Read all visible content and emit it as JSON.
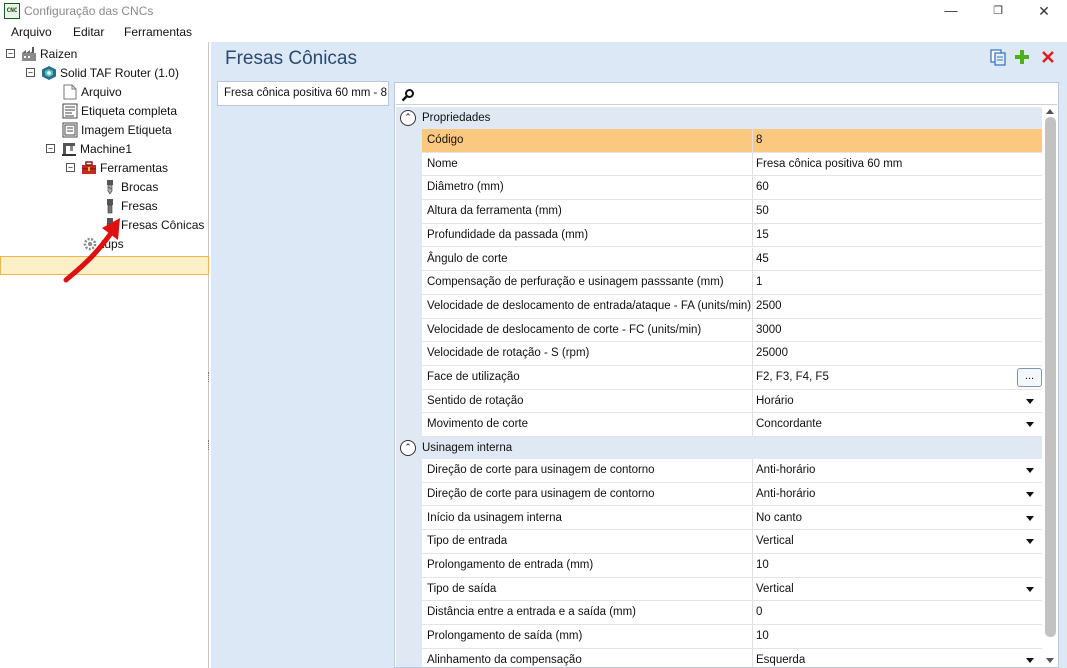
{
  "window": {
    "app_icon_text": "CNC",
    "title": "Configuração das CNCs",
    "minimize": "—",
    "maximize": "❐",
    "close": "✕"
  },
  "menu": [
    "Arquivo",
    "Editar",
    "Ferramentas"
  ],
  "tree": {
    "expand_symbol": "−",
    "nodes": [
      {
        "label": "Raizen",
        "icon": "factory-icon"
      },
      {
        "label": "Solid TAF Router (1.0)",
        "icon": "router-icon"
      },
      {
        "label": "Arquivo",
        "icon": "file-icon"
      },
      {
        "label": "Etiqueta completa",
        "icon": "label-icon"
      },
      {
        "label": "Imagem Etiqueta",
        "icon": "image-label-icon"
      },
      {
        "label": "Machine1",
        "icon": "machine-icon"
      },
      {
        "label": "Ferramentas",
        "icon": "toolbox-icon"
      },
      {
        "label": "Brocas",
        "icon": "drill-bit-icon"
      },
      {
        "label": "Fresas",
        "icon": "mill-icon"
      },
      {
        "label": "Fresas Cônicas",
        "icon": "conical-mill-icon",
        "selected": true
      },
      {
        "label": "tups",
        "icon": "setups-icon"
      }
    ]
  },
  "content": {
    "title": "Fresas Cônicas",
    "header_icons": [
      "copy-icon",
      "add-icon",
      "delete-icon"
    ],
    "header_colors": {
      "add": "#4caf1e",
      "delete": "#e02020",
      "copy": "#3a78c2"
    },
    "tabs": [
      {
        "label": "Fresa cônica positiva 60 mm - 8"
      }
    ],
    "search": {
      "placeholder": "",
      "value": ""
    }
  },
  "accent_colors": {
    "selected_row": "#fbc87f",
    "tree_selected": "#fdf0c9",
    "annotation_arrow": "#e01010"
  },
  "sections": [
    {
      "title": "Propriedades",
      "toggle": "⌃",
      "rows": [
        {
          "name": "Código",
          "value": "8",
          "selected": true
        },
        {
          "name": "Nome",
          "value": "Fresa cônica positiva 60 mm"
        },
        {
          "name": "Diâmetro (mm)",
          "value": "60"
        },
        {
          "name": "Altura da ferramenta (mm)",
          "value": "50"
        },
        {
          "name": "Profundidade da passada (mm)",
          "value": "15"
        },
        {
          "name": "Ângulo de corte",
          "value": "45"
        },
        {
          "name": "Compensação de perfuração e usinagem passsante (mm)",
          "value": "1"
        },
        {
          "name": "Velocidade de deslocamento de entrada/ataque - FA (units/min)",
          "value": "2500"
        },
        {
          "name": "Velocidade de deslocamento de corte - FC (units/min)",
          "value": "3000"
        },
        {
          "name": "Velocidade de rotação - S (rpm)",
          "value": "25000"
        },
        {
          "name": "Face de utilização",
          "value": "F2, F3, F4, F5",
          "editor": "ellipsis",
          "editor_label": "..."
        },
        {
          "name": "Sentido de rotação",
          "value": "Horário",
          "editor": "dropdown"
        },
        {
          "name": "Movimento de corte",
          "value": "Concordante",
          "editor": "dropdown"
        }
      ]
    },
    {
      "title": "Usinagem interna",
      "toggle": "⌃",
      "rows": [
        {
          "name": "Direção de corte para usinagem de contorno",
          "value": "Anti-horário",
          "editor": "dropdown"
        },
        {
          "name": "Direção de corte para usinagem de contorno",
          "value": "Anti-horário",
          "editor": "dropdown"
        },
        {
          "name": "Início da usinagem interna",
          "value": "No canto",
          "editor": "dropdown"
        },
        {
          "name": "Tipo de entrada",
          "value": "Vertical",
          "editor": "dropdown"
        },
        {
          "name": "Prolongamento de entrada (mm)",
          "value": "10"
        },
        {
          "name": "Tipo de saída",
          "value": "Vertical",
          "editor": "dropdown"
        },
        {
          "name": "Distância entre a entrada e a saída (mm)",
          "value": "0"
        },
        {
          "name": "Prolongamento de saída (mm)",
          "value": "10"
        },
        {
          "name": "Alinhamento da compensação",
          "value": "Esquerda",
          "editor": "dropdown"
        }
      ]
    }
  ]
}
